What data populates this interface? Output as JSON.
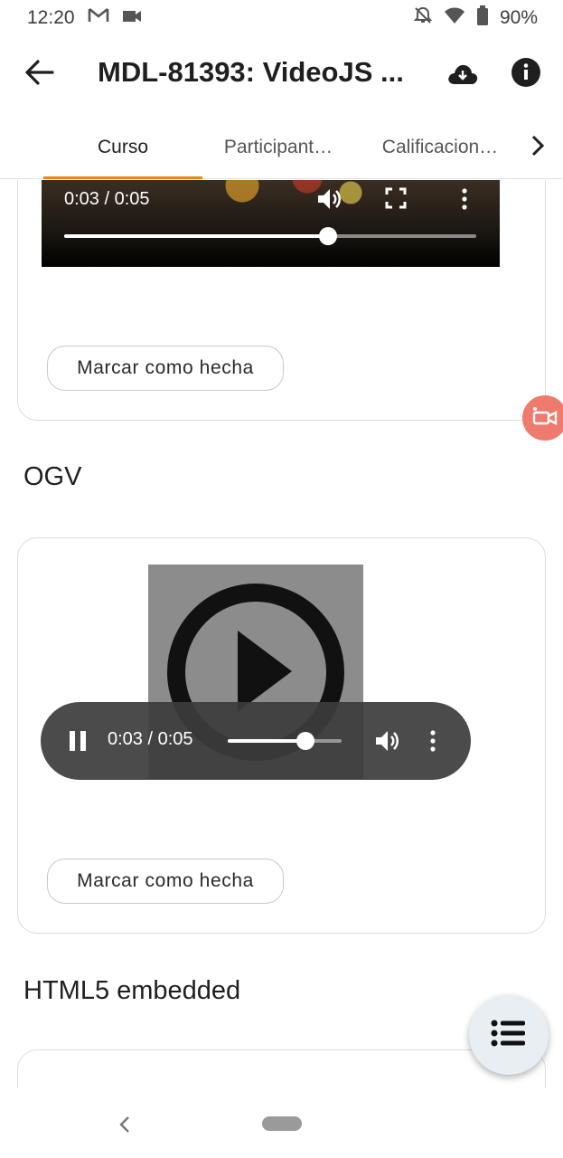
{
  "status_bar": {
    "time": "12:20",
    "battery": "90%",
    "icons": [
      "gmail-icon",
      "video-camera-icon",
      "notifications-off-icon",
      "wifi-icon",
      "battery-icon"
    ]
  },
  "app_bar": {
    "title": "MDL-81393: VideoJS ...",
    "back_icon": "arrow-back-icon",
    "download_icon": "cloud-download-icon",
    "info_icon": "info-icon"
  },
  "tabs": {
    "items": [
      {
        "label": "Curso",
        "active": true
      },
      {
        "label": "Participant…",
        "active": false
      },
      {
        "label": "Calificacion…",
        "active": false
      }
    ],
    "next_icon": "chevron-right-icon",
    "accent": "#f98012"
  },
  "video_player_1": {
    "time": "0:03 / 0:05",
    "progress": 0.64
  },
  "buttons": {
    "mark_done_1": "Marcar como hecha",
    "mark_done_2": "Marcar como hecha"
  },
  "sections": {
    "ogv_title": "OGV",
    "html5_title": "HTML5 embedded"
  },
  "audio_player_ogv": {
    "time": "0:03 / 0:05",
    "progress": 0.68
  },
  "floating": {
    "camera_icon": "video-camera-icon",
    "camera_color": "#ef7a6e",
    "toc_icon": "list-icon"
  },
  "nav_bar": {
    "back_icon": "nav-back-icon",
    "home_icon": "nav-home-pill"
  }
}
